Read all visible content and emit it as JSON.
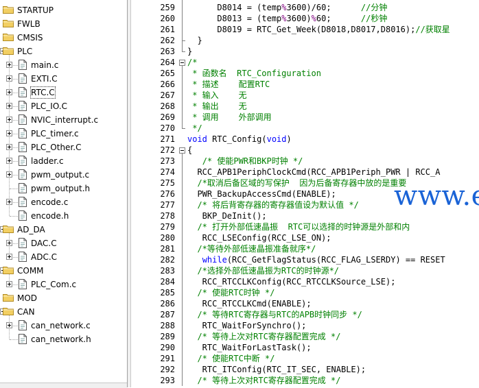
{
  "project_tree": {
    "items": [
      {
        "label": "STARTUP",
        "type": "folder",
        "indent": 0,
        "expand": "none"
      },
      {
        "label": "FWLB",
        "type": "folder",
        "indent": 0,
        "expand": "none"
      },
      {
        "label": "CMSIS",
        "type": "folder",
        "indent": 0,
        "expand": "none"
      },
      {
        "label": "PLC",
        "type": "folder",
        "indent": 0,
        "expand": "minus"
      },
      {
        "label": "main.c",
        "type": "file",
        "indent": 1,
        "expand": "plus"
      },
      {
        "label": "EXTI.C",
        "type": "file",
        "indent": 1,
        "expand": "plus"
      },
      {
        "label": "RTC.C",
        "type": "file",
        "indent": 1,
        "expand": "plus",
        "selected": true
      },
      {
        "label": "PLC_IO.C",
        "type": "file",
        "indent": 1,
        "expand": "plus"
      },
      {
        "label": "NVIC_interrupt.c",
        "type": "file",
        "indent": 1,
        "expand": "plus"
      },
      {
        "label": "PLC_timer.c",
        "type": "file",
        "indent": 1,
        "expand": "plus"
      },
      {
        "label": "PLC_Other.C",
        "type": "file",
        "indent": 1,
        "expand": "plus"
      },
      {
        "label": "ladder.c",
        "type": "file",
        "indent": 1,
        "expand": "plus"
      },
      {
        "label": "pwm_output.c",
        "type": "file",
        "indent": 1,
        "expand": "plus"
      },
      {
        "label": "pwm_output.h",
        "type": "file",
        "indent": 1,
        "expand": "none"
      },
      {
        "label": "encode.c",
        "type": "file",
        "indent": 1,
        "expand": "plus"
      },
      {
        "label": "encode.h",
        "type": "file",
        "indent": 1,
        "expand": "none"
      },
      {
        "label": "AD_DA",
        "type": "folder",
        "indent": 0,
        "expand": "minus"
      },
      {
        "label": "DAC.C",
        "type": "file",
        "indent": 1,
        "expand": "plus"
      },
      {
        "label": "ADC.C",
        "type": "file",
        "indent": 1,
        "expand": "plus"
      },
      {
        "label": "COMM",
        "type": "folder",
        "indent": 0,
        "expand": "minus"
      },
      {
        "label": "PLC_Com.c",
        "type": "file",
        "indent": 1,
        "expand": "plus"
      },
      {
        "label": "MOD",
        "type": "folder",
        "indent": 0,
        "expand": "none"
      },
      {
        "label": "CAN",
        "type": "folder",
        "indent": 0,
        "expand": "minus"
      },
      {
        "label": "can_network.c",
        "type": "file",
        "indent": 1,
        "expand": "plus"
      },
      {
        "label": "can_network.h",
        "type": "file",
        "indent": 1,
        "expand": "none"
      }
    ]
  },
  "editor": {
    "lines": [
      {
        "n": "259",
        "fold": "",
        "segs": [
          [
            "",
            "      D8014 = (temp"
          ],
          [
            "n",
            "%"
          ],
          [
            "",
            "3600)/60;      "
          ],
          [
            "c",
            "//分钟"
          ]
        ]
      },
      {
        "n": "260",
        "fold": "",
        "segs": [
          [
            "",
            "      D8013 = (temp"
          ],
          [
            "n",
            "%"
          ],
          [
            "",
            "3600)"
          ],
          [
            "n",
            "%"
          ],
          [
            "",
            "60;      "
          ],
          [
            "c",
            "//秒钟"
          ]
        ]
      },
      {
        "n": "261",
        "fold": "",
        "segs": [
          [
            "",
            "      D8019 = RTC_Get_Week(D8018,D8017,D8016);"
          ],
          [
            "c",
            "//获取星"
          ]
        ]
      },
      {
        "n": "262",
        "fold": "",
        "segs": [
          [
            "",
            "  }"
          ]
        ]
      },
      {
        "n": "263",
        "fold": "",
        "segs": [
          [
            "",
            "}"
          ]
        ]
      },
      {
        "n": "264",
        "fold": "minus",
        "segs": [
          [
            "c",
            "/*"
          ]
        ]
      },
      {
        "n": "265",
        "fold": "",
        "segs": [
          [
            "c",
            " * 函数名  RTC_Configuration"
          ]
        ]
      },
      {
        "n": "266",
        "fold": "",
        "segs": [
          [
            "c",
            " * 描述    配置RTC"
          ]
        ]
      },
      {
        "n": "267",
        "fold": "",
        "segs": [
          [
            "c",
            " * 输入    无"
          ]
        ]
      },
      {
        "n": "268",
        "fold": "",
        "segs": [
          [
            "c",
            " * 输出    无"
          ]
        ]
      },
      {
        "n": "269",
        "fold": "",
        "segs": [
          [
            "c",
            " * 调用    外部调用"
          ]
        ]
      },
      {
        "n": "270",
        "fold": "",
        "segs": [
          [
            "c",
            " */"
          ]
        ]
      },
      {
        "n": "271",
        "fold": "",
        "segs": [
          [
            "k",
            "void"
          ],
          [
            "",
            " RTC_Config("
          ],
          [
            "k",
            "void"
          ],
          [
            "",
            ")"
          ]
        ]
      },
      {
        "n": "272",
        "fold": "minus",
        "segs": [
          [
            "",
            "{"
          ]
        ]
      },
      {
        "n": "273",
        "fold": "",
        "segs": [
          [
            "",
            "   "
          ],
          [
            "c",
            "/* 使能PWR和BKP时钟 */"
          ]
        ]
      },
      {
        "n": "274",
        "fold": "",
        "segs": [
          [
            "",
            "  RCC_APB1PeriphClockCmd(RCC_APB1Periph_PWR | RCC_A"
          ]
        ]
      },
      {
        "n": "275",
        "fold": "",
        "segs": [
          [
            "",
            "  "
          ],
          [
            "c",
            "/*取消后备区域的写保护  因为后备寄存器中放的是重要"
          ]
        ]
      },
      {
        "n": "276",
        "fold": "",
        "segs": [
          [
            "",
            "  PWR_BackupAccessCmd(ENABLE);"
          ]
        ]
      },
      {
        "n": "277",
        "fold": "",
        "segs": [
          [
            "",
            "  "
          ],
          [
            "c",
            "/* 将后背寄存器的寄存器值设为默认值 */"
          ]
        ]
      },
      {
        "n": "278",
        "fold": "",
        "segs": [
          [
            "",
            "   BKP_DeInit();"
          ]
        ]
      },
      {
        "n": "279",
        "fold": "",
        "segs": [
          [
            "",
            "  "
          ],
          [
            "c",
            "/* 打开外部低速晶振  RTC可以选择的时钟源是外部和内"
          ]
        ]
      },
      {
        "n": "280",
        "fold": "",
        "segs": [
          [
            "",
            "   RCC_LSEConfig(RCC_LSE_ON);"
          ]
        ]
      },
      {
        "n": "281",
        "fold": "",
        "segs": [
          [
            "",
            "  "
          ],
          [
            "c",
            "/*等待外部低速晶振准备就序*/"
          ]
        ]
      },
      {
        "n": "282",
        "fold": "",
        "segs": [
          [
            "",
            "   "
          ],
          [
            "k",
            "while"
          ],
          [
            "",
            "(RCC_GetFlagStatus(RCC_FLAG_LSERDY) == RESET"
          ]
        ]
      },
      {
        "n": "283",
        "fold": "",
        "segs": [
          [
            "",
            "  "
          ],
          [
            "c",
            "/*选择外部低速晶振为RTC的时钟源*/"
          ]
        ]
      },
      {
        "n": "284",
        "fold": "",
        "segs": [
          [
            "",
            "   RCC_RTCCLKConfig(RCC_RTCCLKSource_LSE);"
          ]
        ]
      },
      {
        "n": "285",
        "fold": "",
        "segs": [
          [
            "",
            "  "
          ],
          [
            "c",
            "/* 使能RTC时钟 */"
          ]
        ]
      },
      {
        "n": "286",
        "fold": "",
        "segs": [
          [
            "",
            "   RCC_RTCCLKCmd(ENABLE);"
          ]
        ]
      },
      {
        "n": "287",
        "fold": "",
        "segs": [
          [
            "",
            "  "
          ],
          [
            "c",
            "/* 等待RTC寄存器与RTC的APB时钟同步 */"
          ]
        ]
      },
      {
        "n": "288",
        "fold": "",
        "segs": [
          [
            "",
            "   RTC_WaitForSynchro();"
          ]
        ]
      },
      {
        "n": "289",
        "fold": "",
        "segs": [
          [
            "",
            "  "
          ],
          [
            "c",
            "/* 等待上次对RTC寄存器配置完成 */"
          ]
        ]
      },
      {
        "n": "290",
        "fold": "",
        "segs": [
          [
            "",
            "   RTC_WaitForLastTask();"
          ]
        ]
      },
      {
        "n": "291",
        "fold": "",
        "segs": [
          [
            "",
            "  "
          ],
          [
            "c",
            "/* 使能RTC中断 */"
          ]
        ]
      },
      {
        "n": "292",
        "fold": "",
        "segs": [
          [
            "",
            "   RTC_ITConfig(RTC_IT_SEC, ENABLE);"
          ]
        ]
      },
      {
        "n": "293",
        "fold": "",
        "segs": [
          [
            "",
            "  "
          ],
          [
            "c",
            "/* 等待上次对RTC寄存器配置完成 */"
          ]
        ]
      }
    ]
  },
  "watermark": {
    "text": "www.elecfans.com"
  },
  "colors": {
    "comment": "#008000",
    "keyword": "#0000ff",
    "operator": "#7f007f",
    "watermark": "#1a63d6",
    "folder": "#f2cf63"
  }
}
